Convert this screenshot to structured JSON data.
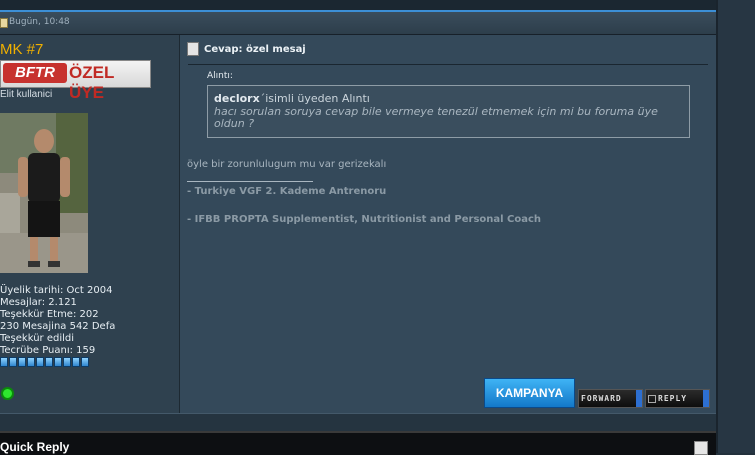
{
  "post": {
    "date": "Bugün, 10:48",
    "title": "Cevap: özel mesaj",
    "quote_label": "Alıntı:",
    "quote_author": "declorx",
    "quote_suffix": "´isimli üyeden Alıntı",
    "quote_text": "hacı sorulan soruya cevap bile vermeye tenezül etmemek için mi bu foruma üye oldun ?",
    "body": "öyle bir zorunlulugum mu var gerizekalı",
    "signature": [
      "- Turkiye VGF 2. Kademe Antrenoru",
      "- IFBB PROPTA Supplementist, Nutritionist and Personal Coach"
    ]
  },
  "user": {
    "name": "MK #7",
    "rank_badge_left": "BFTR",
    "rank_badge_right": "ÖZEL ÜYE",
    "title": "Elit kullanici",
    "info": [
      "Üyelik tarihi: Oct 2004",
      "Mesajlar: 2.121",
      "Teşekkür Etme: 202",
      "230 Mesajina 542 Defa",
      "Teşekkür edildi",
      "Tecrübe Puanı: 159"
    ],
    "reputation_pips": 10
  },
  "buttons": {
    "kampanya": "KAMPANYA",
    "forward": "FORWARD",
    "reply": "REPLY"
  },
  "quick_reply": {
    "title": "Quick Reply"
  },
  "colors": {
    "username": "#f0b000",
    "accent_blue": "#3c8fd6",
    "online": "#2ee62e"
  }
}
